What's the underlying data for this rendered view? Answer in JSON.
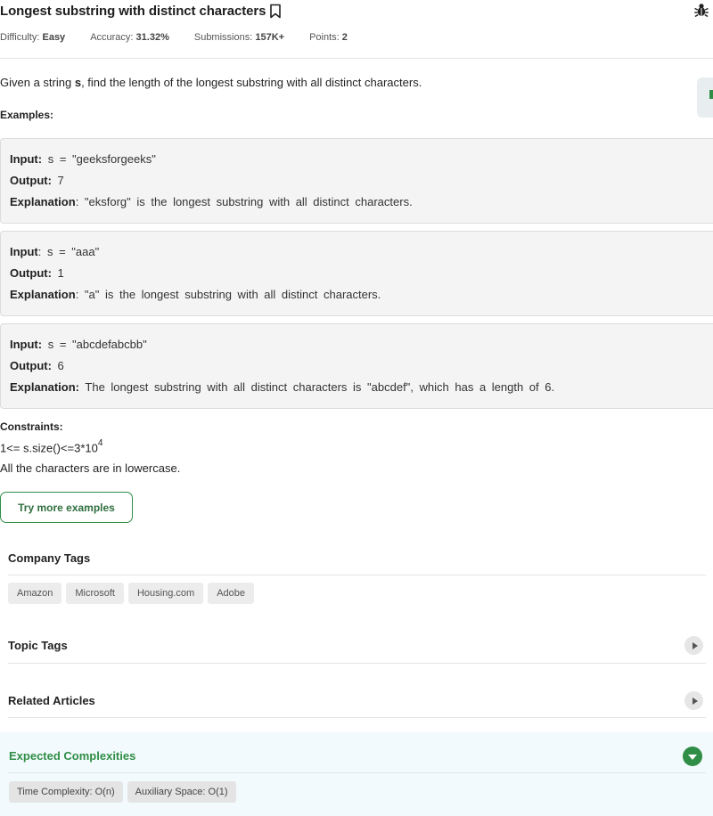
{
  "header": {
    "title": "Longest substring with distinct characters",
    "bookmark_icon": "bookmark-icon",
    "bug_icon": "bug-icon",
    "meta": {
      "difficulty_label": "Difficulty:",
      "difficulty_value": "Easy",
      "accuracy_label": "Accuracy:",
      "accuracy_value": "31.32%",
      "submissions_label": "Submissions:",
      "submissions_value": "157K+",
      "points_label": "Points:",
      "points_value": "2"
    }
  },
  "problem": {
    "text_before": "Given a string ",
    "var": "s",
    "text_after": ", find the length of the longest substring with all distinct characters."
  },
  "examples_label": "Examples:",
  "examples": [
    {
      "input_label": "Input:",
      "input": "s = \"geeksforgeeks\"",
      "output_label": "Output:",
      "output": "7",
      "explanation_label": "Explanation",
      "explanation": ": \"eksforg\" is the longest substring with all distinct characters."
    },
    {
      "input_label": "Input",
      "input": ": s = \"aaa\"",
      "output_label": "Output:",
      "output": "1",
      "explanation_label": "Explanation",
      "explanation": ": \"a\" is the longest substring with all distinct characters."
    },
    {
      "input_label": "Input:",
      "input": "s = \"abcdefabcbb\"",
      "output_label": "Output:",
      "output": "6",
      "explanation_label": "Explanation:",
      "explanation": "The longest substring with all distinct characters is \"abcdef\", which has a length of 6."
    }
  ],
  "constraints": {
    "label": "Constraints:",
    "line1": "1<= s.size()<=3*10",
    "line1_sup": "4",
    "line2": "All the characters are in lowercase."
  },
  "try_more_label": "Try more examples",
  "company_tags": {
    "title": "Company Tags",
    "tags": [
      "Amazon",
      "Microsoft",
      "Housing.com",
      "Adobe"
    ]
  },
  "topic_tags": {
    "title": "Topic Tags"
  },
  "related_articles": {
    "title": "Related Articles"
  },
  "expected_complexities": {
    "title": "Expected Complexities",
    "time": "Time Complexity: O(n)",
    "space": "Auxiliary Space: O(1)"
  },
  "colors": {
    "accent_green": "#2f8d46",
    "tag_bg": "#ececec",
    "example_bg": "#f4f4f4"
  }
}
